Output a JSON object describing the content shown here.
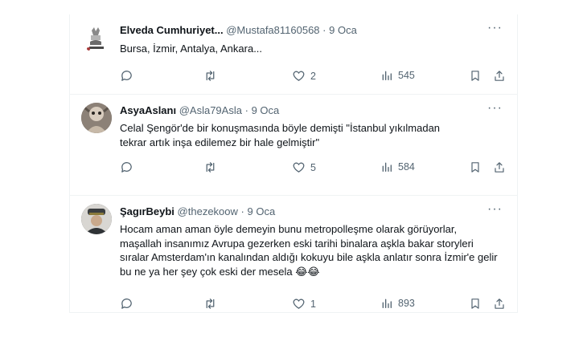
{
  "tweets": [
    {
      "name": "Elveda Cumhuriyet...",
      "handle": "@Mustafa81160568",
      "dot": "·",
      "date": "9 Oca",
      "text": "Bursa, İzmir, Antalya, Ankara...",
      "reply_count": "",
      "retweet_count": "",
      "like_count": "2",
      "view_count": "545"
    },
    {
      "name": "AsyaAslanı",
      "handle": "@Asla79Asla",
      "dot": "·",
      "date": "9 Oca",
      "text": "Celal Şengör'de bir konuşmasında böyle demişti \"İstanbul yıkılmadan tekrar artık inşa edilemez bir hale gelmiştir\"",
      "reply_count": "",
      "retweet_count": "",
      "like_count": "5",
      "view_count": "584"
    },
    {
      "name": "ŞagırBeybi",
      "handle": "@thezekoow",
      "dot": "·",
      "date": "9 Oca",
      "text": "Hocam aman aman öyle demeyin bunu metropolleşme olarak görüyorlar, maşallah insanımız Avrupa gezerken eski tarihi binalara aşkla bakar storyleri sıralar Amsterdam'ın kanalından aldığı kokuyu bile aşkla anlatır sonra İzmir'e gelir bu ne ya her şey çok eski der mesela 😂😂",
      "reply_count": "",
      "retweet_count": "",
      "like_count": "1",
      "view_count": "893"
    }
  ],
  "more_glyph": "···",
  "colors": {
    "text": "#0f1419",
    "muted": "#536471",
    "border": "#eff3f4"
  }
}
